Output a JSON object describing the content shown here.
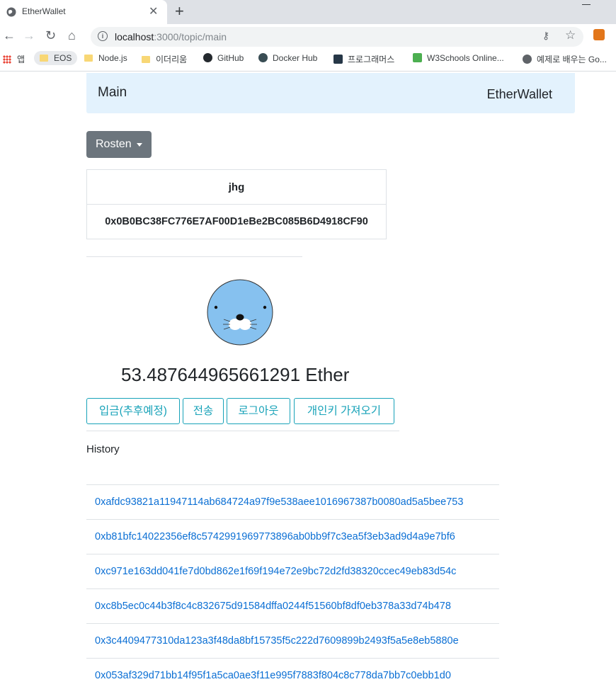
{
  "browser": {
    "tab_title": "EtherWallet",
    "url_host": "localhost",
    "url_rest": ":3000/topic/main",
    "bookmarks": {
      "apps": "앱",
      "eos": "EOS",
      "node": "Node.js",
      "ethereum": "이더리움",
      "github": "GitHub",
      "docker": "Docker Hub",
      "programmers": "프로그래머스",
      "w3": "W3Schools Online...",
      "goexample": "예제로 배우는 Go..."
    }
  },
  "navbar": {
    "brand": "Main",
    "right": "EtherWallet"
  },
  "network_dropdown": "Rosten",
  "account": {
    "name": "jhg",
    "address": "0x0B0BC38FC776E7AF00D1eBe2BC085B6D4918CF90"
  },
  "balance": "53.487644965661291 Ether",
  "actions": {
    "deposit": "입금(추후예정)",
    "send": "전송",
    "logout": "로그아웃",
    "import_key": "개인키 가져오기"
  },
  "history": {
    "title": "History",
    "transactions": [
      "0xafdc93821a11947114ab684724a97f9e538aee1016967387b0080ad5a5bee753",
      "0xb81bfc14022356ef8c5742991969773896ab0bb9f7c3ea5f3eb3ad9d4a9e7bf6",
      "0xc971e163dd041fe7d0bd862e1f69f194e72e9bc72d2fd38320ccec49eb83d54c",
      "0xc8b5ec0c44b3f8c4c832675d91584dffa0244f51560bf8df0eb378a33d74b478",
      "0x3c4409477310da123a3f48da8bf15735f5c222d7609899b2493f5a5e8eb5880e",
      "0x053af329d71bb14f95f1a5ca0ae3f11e995f7883f804c8c778da7bb7c0ebb1d0"
    ]
  },
  "colors": {
    "navbar_bg": "#e3f2fd",
    "dropdown_bg": "#6c757d",
    "button_accent": "#17a2b8",
    "link": "#0b6fd4",
    "avatar_fill": "#86c1ef"
  }
}
